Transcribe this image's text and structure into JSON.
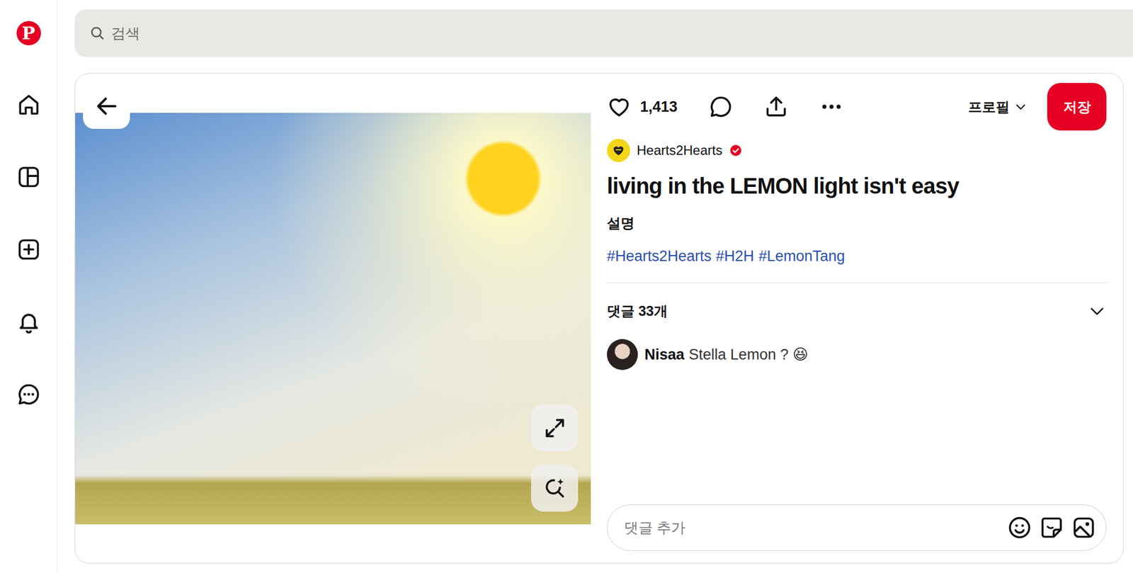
{
  "sidebar": {
    "logo": "P"
  },
  "search": {
    "placeholder": "검색"
  },
  "pin": {
    "likes": "1,413",
    "profile_menu": "프로필",
    "save_button": "저장",
    "author": {
      "name": "Hearts2Hearts",
      "verified": true
    },
    "title": "living in the LEMON light isn't easy",
    "description_label": "설명",
    "tags": [
      "#Hearts2Hearts",
      "#H2H",
      "#LemonTang"
    ],
    "comments_heading": "댓글 33개",
    "comments": [
      {
        "author": "Nisaa",
        "text": "Stella Lemon ? 😆"
      }
    ],
    "comment_input": {
      "placeholder": "댓글 추가"
    }
  }
}
